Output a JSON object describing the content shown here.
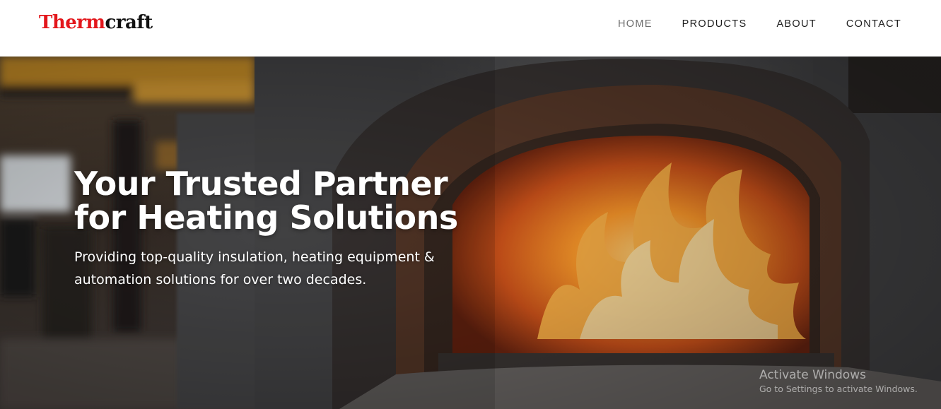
{
  "header": {
    "logo": {
      "part1": "Therm",
      "part2": "craft"
    },
    "nav": [
      {
        "label": "HOME",
        "active": true
      },
      {
        "label": "PRODUCTS",
        "active": false
      },
      {
        "label": "ABOUT",
        "active": false
      },
      {
        "label": "CONTACT",
        "active": false
      }
    ]
  },
  "hero": {
    "title_line1": "Your Trusted Partner",
    "title_line2": "for Heating Solutions",
    "subtitle_line1": "Providing top-quality insulation, heating equipment &",
    "subtitle_line2": "automation solutions for over two decades.",
    "background_icon": "furnace-fire-photo"
  },
  "watermark": {
    "title": "Activate Windows",
    "subtitle": "Go to Settings to activate Windows."
  },
  "colors": {
    "brand_red": "#e3161b",
    "brand_dark": "#111111",
    "nav_text": "#1c1c1c",
    "nav_active": "#6d6d6d",
    "hero_text": "#ffffff"
  }
}
